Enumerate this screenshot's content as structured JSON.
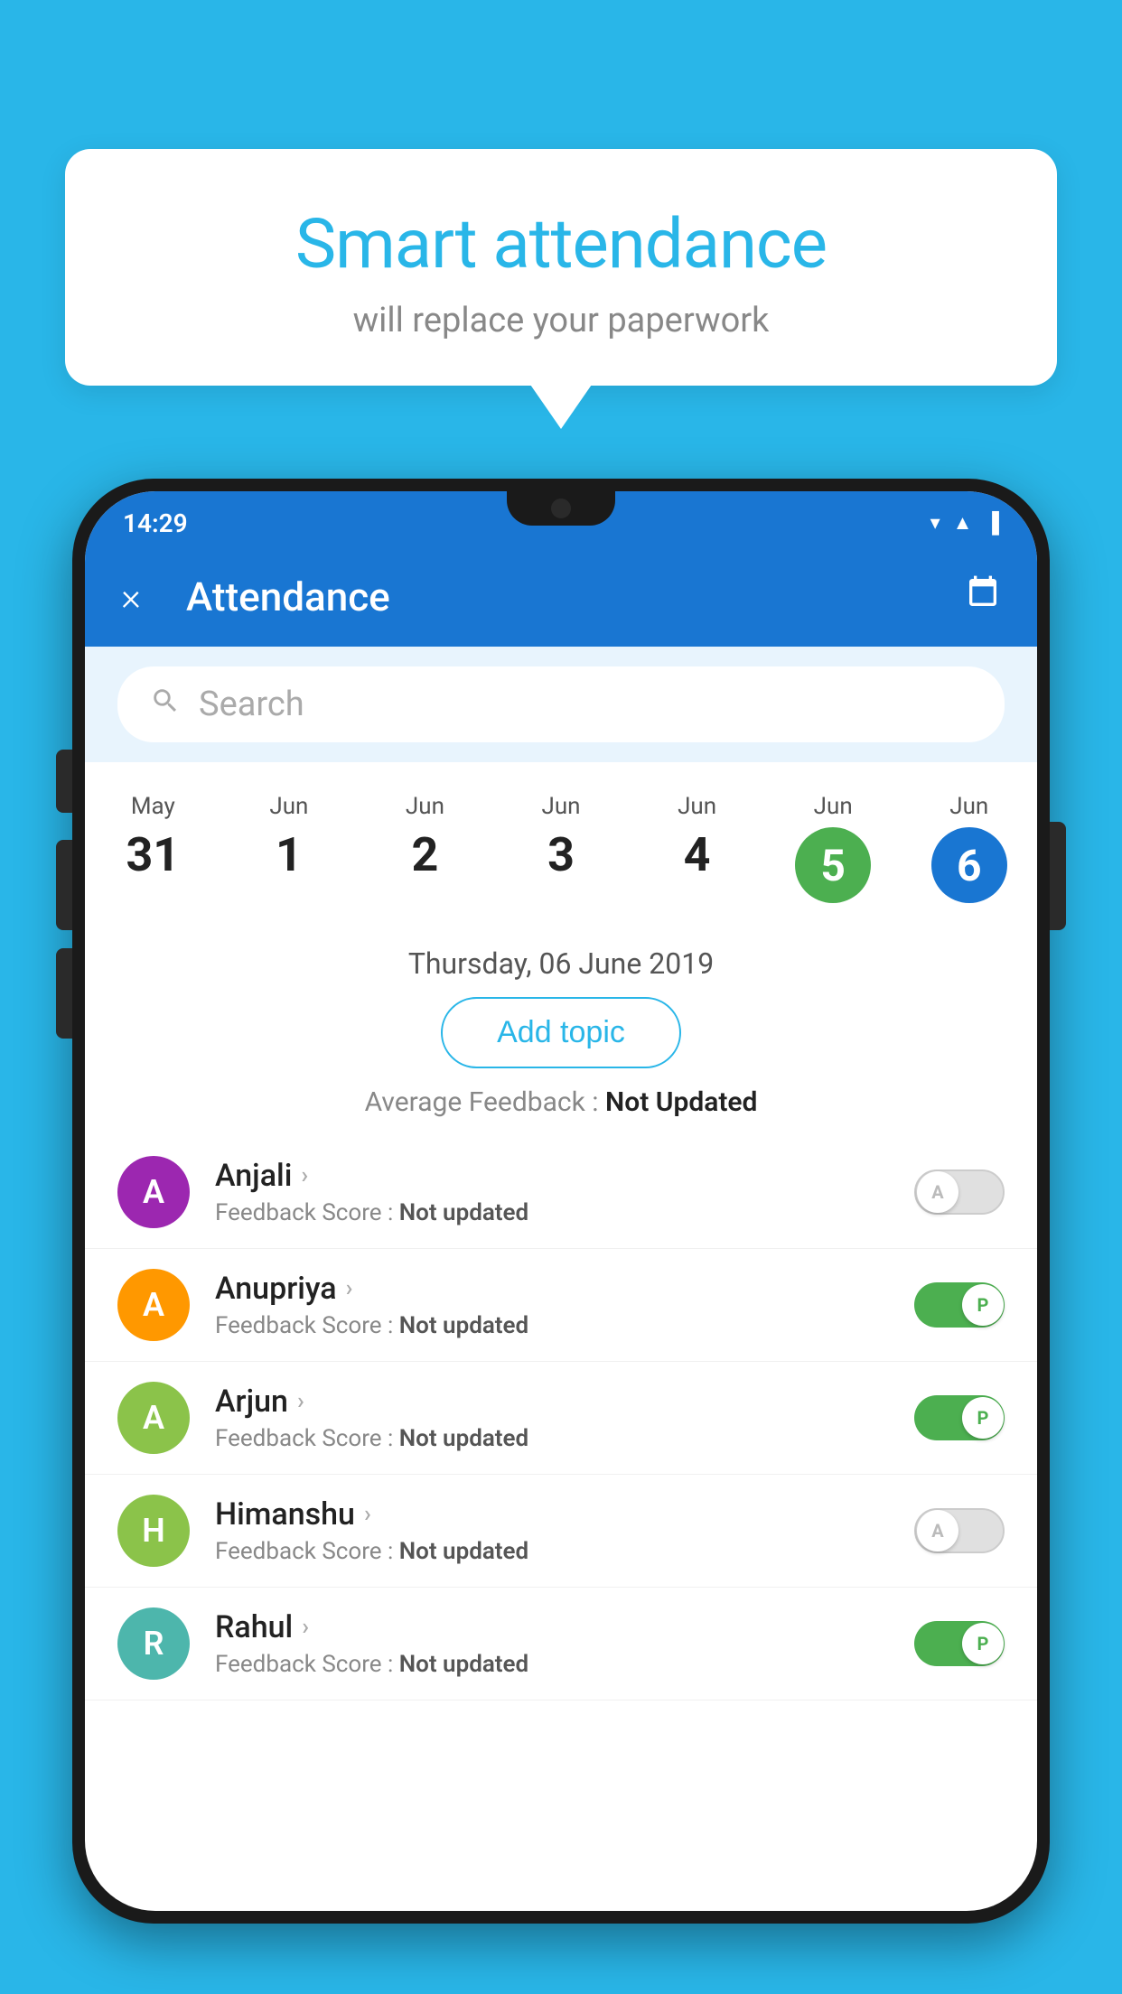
{
  "background_color": "#29b6e8",
  "speech_bubble": {
    "title": "Smart attendance",
    "subtitle": "will replace your paperwork"
  },
  "status_bar": {
    "time": "14:29",
    "icons": [
      "wifi",
      "signal",
      "battery"
    ]
  },
  "app_bar": {
    "title": "Attendance",
    "close_label": "×",
    "calendar_label": "📅"
  },
  "search": {
    "placeholder": "Search"
  },
  "dates": [
    {
      "month": "May",
      "day": "31",
      "active": false
    },
    {
      "month": "Jun",
      "day": "1",
      "active": false
    },
    {
      "month": "Jun",
      "day": "2",
      "active": false
    },
    {
      "month": "Jun",
      "day": "3",
      "active": false
    },
    {
      "month": "Jun",
      "day": "4",
      "active": false
    },
    {
      "month": "Jun",
      "day": "5",
      "active": "green"
    },
    {
      "month": "Jun",
      "day": "6",
      "active": "blue"
    }
  ],
  "selected_date": "Thursday, 06 June 2019",
  "add_topic_label": "Add topic",
  "avg_feedback_label": "Average Feedback :",
  "avg_feedback_value": "Not Updated",
  "students": [
    {
      "name": "Anjali",
      "avatar_letter": "A",
      "avatar_color": "#9c27b0",
      "feedback_label": "Feedback Score :",
      "feedback_value": "Not updated",
      "toggle": "off",
      "toggle_letter": "A"
    },
    {
      "name": "Anupriya",
      "avatar_letter": "A",
      "avatar_color": "#ff9800",
      "feedback_label": "Feedback Score :",
      "feedback_value": "Not updated",
      "toggle": "on",
      "toggle_letter": "P"
    },
    {
      "name": "Arjun",
      "avatar_letter": "A",
      "avatar_color": "#8bc34a",
      "feedback_label": "Feedback Score :",
      "feedback_value": "Not updated",
      "toggle": "on",
      "toggle_letter": "P"
    },
    {
      "name": "Himanshu",
      "avatar_letter": "H",
      "avatar_color": "#8bc34a",
      "feedback_label": "Feedback Score :",
      "feedback_value": "Not updated",
      "toggle": "off",
      "toggle_letter": "A"
    },
    {
      "name": "Rahul",
      "avatar_letter": "R",
      "avatar_color": "#4db6ac",
      "feedback_label": "Feedback Score :",
      "feedback_value": "Not updated",
      "toggle": "on",
      "toggle_letter": "P"
    }
  ]
}
